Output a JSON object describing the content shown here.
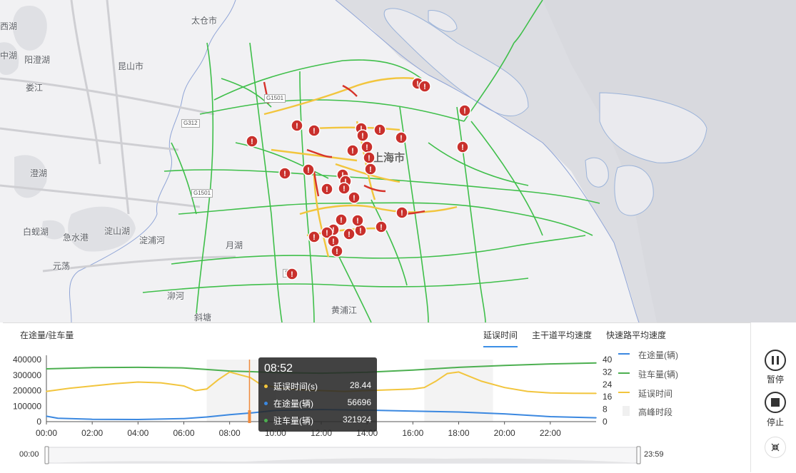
{
  "map": {
    "places": [
      {
        "text": "太仓市",
        "cls": ""
      },
      {
        "text": "昆山市",
        "cls": ""
      },
      {
        "text": "阳澄湖",
        "cls": ""
      },
      {
        "text": "中湖",
        "cls": ""
      },
      {
        "text": "西湖",
        "cls": ""
      },
      {
        "text": "娄江",
        "cls": ""
      },
      {
        "text": "澄湖",
        "cls": ""
      },
      {
        "text": "白蚬湖",
        "cls": ""
      },
      {
        "text": "急水港",
        "cls": ""
      },
      {
        "text": "淀山湖",
        "cls": ""
      },
      {
        "text": "淀浦河",
        "cls": ""
      },
      {
        "text": "元荡",
        "cls": ""
      },
      {
        "text": "月湖",
        "cls": ""
      },
      {
        "text": "泖河",
        "cls": ""
      },
      {
        "text": "斜塘",
        "cls": ""
      },
      {
        "text": "黄浦江",
        "cls": ""
      },
      {
        "text": "上海市",
        "cls": "big"
      }
    ],
    "road_tags": [
      "G1501",
      "G312",
      "G1501",
      "S1"
    ],
    "incident_icon": "warning-marker-icon"
  },
  "panel": {
    "title": "在途量/驻车量",
    "tabs": [
      {
        "label": "延误时间",
        "active": true
      },
      {
        "label": "主干道平均速度",
        "active": false
      },
      {
        "label": "快速路平均速度",
        "active": false
      }
    ]
  },
  "legend": [
    {
      "label": "在途量(辆)",
      "color": "#3b88e0"
    },
    {
      "label": "驻车量(辆)",
      "color": "#4caf50"
    },
    {
      "label": "延误时间",
      "color": "#f2c53d"
    },
    {
      "label": "高峰时段",
      "color": "#f0f0f0"
    }
  ],
  "tooltip": {
    "time": "08:52",
    "rows": [
      {
        "label": "延误时间(s)",
        "value": "28.44",
        "color": "#f2c53d"
      },
      {
        "label": "在途量(辆)",
        "value": "56696",
        "color": "#3b88e0"
      },
      {
        "label": "驻车量(辆)",
        "value": "321924",
        "color": "#4caf50"
      }
    ]
  },
  "chart_data": {
    "type": "line",
    "x_ticks": [
      "00:00",
      "02:00",
      "04:00",
      "06:00",
      "08:00",
      "10:00",
      "12:00",
      "14:00",
      "16:00",
      "18:00",
      "20:00",
      "22:00"
    ],
    "y_left_ticks": [
      "400000",
      "300000",
      "200000",
      "100000",
      "0"
    ],
    "y_right_ticks": [
      "40",
      "32",
      "24",
      "16",
      "8",
      "0"
    ],
    "ylim_left": [
      0,
      400000
    ],
    "ylim_right": [
      0,
      40
    ],
    "peak_periods": [
      [
        "07:00",
        "10:00"
      ],
      [
        "16:30",
        "19:30"
      ]
    ],
    "cursor_time": "08:52",
    "series": [
      {
        "name": "在途量(辆)",
        "axis": "left",
        "color": "#3b88e0",
        "x": [
          0,
          0.5,
          2,
          4,
          6,
          7,
          8,
          9,
          10,
          12,
          14,
          16,
          18,
          20,
          22,
          24
        ],
        "values": [
          35000,
          22000,
          15000,
          14000,
          20000,
          30000,
          45000,
          57000,
          72000,
          78000,
          74000,
          68000,
          62000,
          50000,
          32000,
          25000
        ]
      },
      {
        "name": "驻车量(辆)",
        "axis": "left",
        "color": "#4caf50",
        "x": [
          0,
          2,
          4,
          6,
          7,
          8,
          9,
          10,
          12,
          14,
          16,
          18,
          20,
          22,
          24
        ],
        "values": [
          340000,
          348000,
          350000,
          346000,
          336000,
          326000,
          321924,
          316000,
          312000,
          318000,
          332000,
          350000,
          362000,
          372000,
          378000
        ]
      },
      {
        "name": "延误时间",
        "axis": "right",
        "color": "#f2c53d",
        "x": [
          0,
          1,
          2,
          3,
          4,
          5,
          6,
          6.5,
          7,
          7.5,
          8,
          8.5,
          8.9,
          9.3,
          10,
          11,
          12,
          13,
          14,
          15,
          16,
          16.5,
          17,
          17.5,
          18,
          18.5,
          19,
          20,
          21,
          22,
          23,
          24
        ],
        "values": [
          19.5,
          21.5,
          23,
          24.5,
          25.5,
          25,
          23,
          20,
          21,
          27,
          32,
          30,
          28.4,
          24.5,
          22,
          20.5,
          20,
          19.5,
          20,
          20.5,
          21,
          22,
          26,
          31,
          32,
          29,
          26,
          22,
          19.5,
          18.5,
          18.3,
          18.2
        ]
      }
    ]
  },
  "timeline": {
    "start": "00:00",
    "end": "23:59"
  },
  "controls": {
    "pause_label": "暂停",
    "stop_label": "停止"
  }
}
